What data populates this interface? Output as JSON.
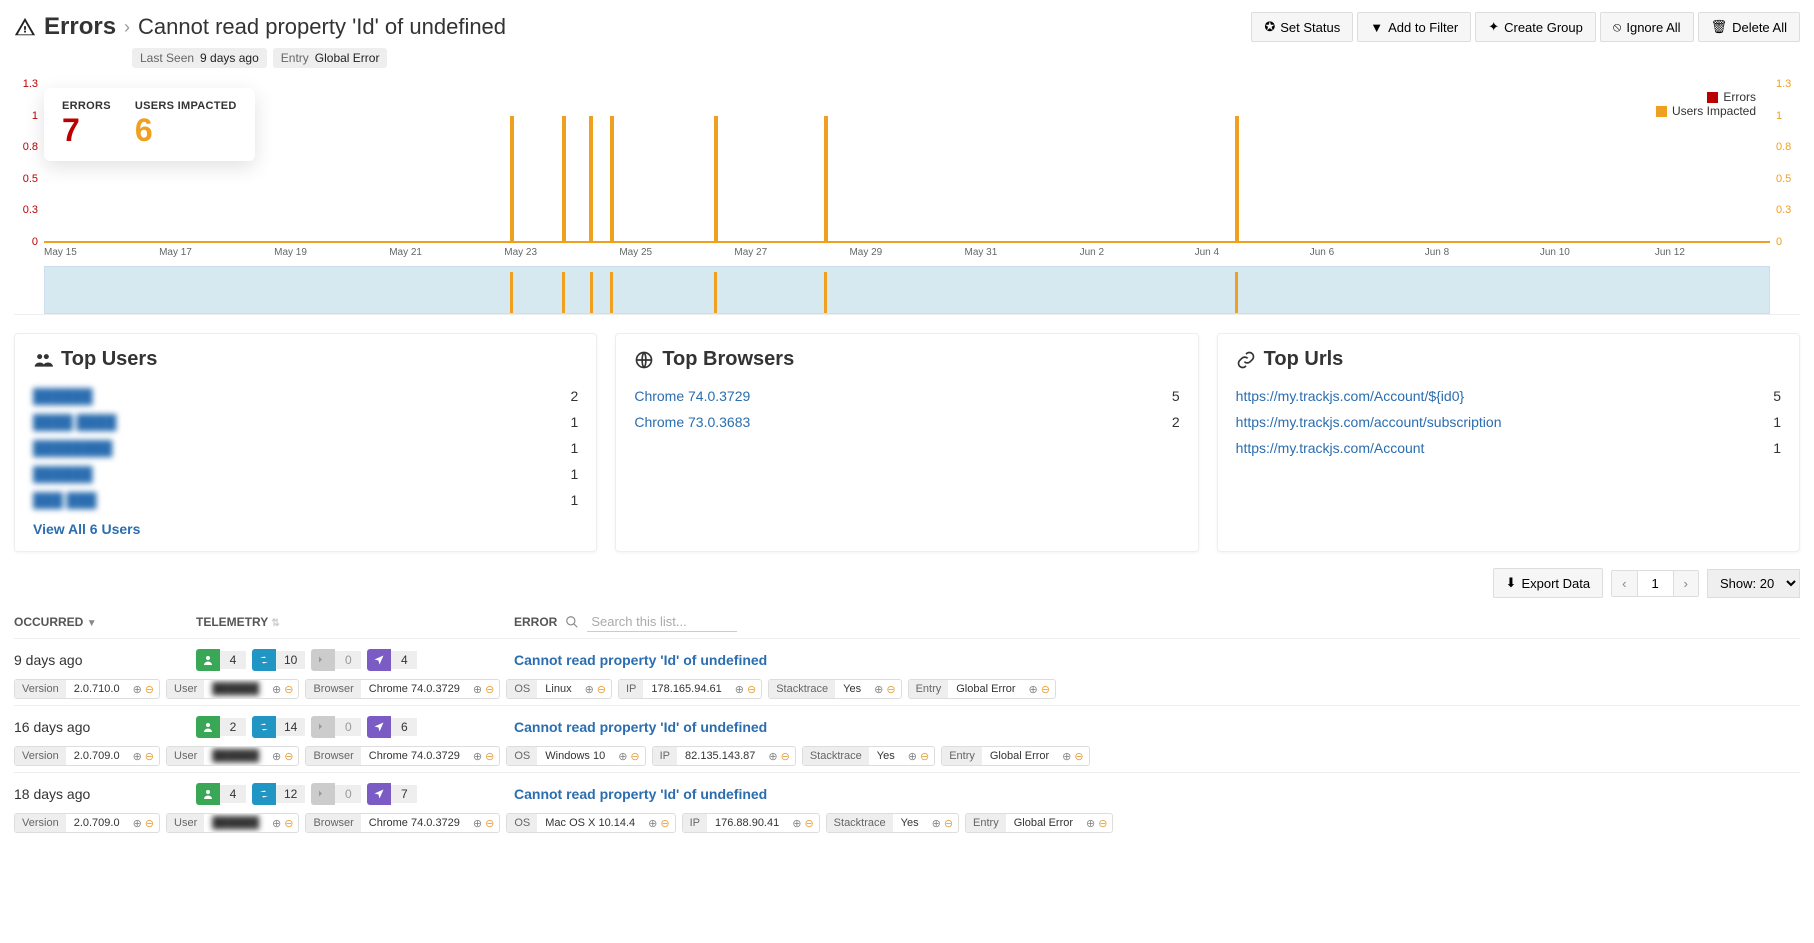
{
  "header": {
    "title": "Errors",
    "subtitle": "Cannot read property 'Id' of undefined",
    "actions": {
      "set_status": "Set Status",
      "add_filter": "Add to Filter",
      "create_group": "Create Group",
      "ignore_all": "Ignore All",
      "delete_all": "Delete All"
    },
    "tags": [
      {
        "key": "Last Seen",
        "val": "9 days ago"
      },
      {
        "key": "Entry",
        "val": "Global Error"
      }
    ]
  },
  "stats": {
    "errors_label": "ERRORS",
    "errors_value": "7",
    "users_label": "USERS IMPACTED",
    "users_value": "6"
  },
  "legend": {
    "errors": "Errors",
    "users": "Users Impacted"
  },
  "chart_data": {
    "type": "bar",
    "y_ticks": [
      "1.3",
      "1",
      "0.8",
      "0.5",
      "0.3",
      "0"
    ],
    "categories": [
      "May 15",
      "May 17",
      "May 19",
      "May 21",
      "May 23",
      "May 25",
      "May 27",
      "May 29",
      "May 31",
      "Jun 2",
      "Jun 4",
      "Jun 6",
      "Jun 8",
      "Jun 10",
      "Jun 12"
    ],
    "bars": [
      {
        "pct": 27.0,
        "h": 1
      },
      {
        "pct": 30.0,
        "h": 1
      },
      {
        "pct": 31.6,
        "h": 1
      },
      {
        "pct": 32.8,
        "h": 1
      },
      {
        "pct": 38.8,
        "h": 1
      },
      {
        "pct": 45.2,
        "h": 1
      },
      {
        "pct": 69.0,
        "h": 1
      }
    ],
    "ylim": [
      0,
      1.3
    ]
  },
  "top_users": {
    "title": "Top Users",
    "rows": [
      {
        "name": "██████",
        "count": "2"
      },
      {
        "name": "████ ████",
        "count": "1"
      },
      {
        "name": "████████",
        "count": "1"
      },
      {
        "name": "██████",
        "count": "1"
      },
      {
        "name": "███ ███",
        "count": "1"
      }
    ],
    "viewall": "View All 6 Users"
  },
  "top_browsers": {
    "title": "Top Browsers",
    "rows": [
      {
        "name": "Chrome 74.0.3729",
        "count": "5"
      },
      {
        "name": "Chrome 73.0.3683",
        "count": "2"
      }
    ]
  },
  "top_urls": {
    "title": "Top Urls",
    "rows": [
      {
        "name": "https://my.trackjs.com/Account/${id0}",
        "count": "5"
      },
      {
        "name": "https://my.trackjs.com/account/subscription",
        "count": "1"
      },
      {
        "name": "https://my.trackjs.com/Account",
        "count": "1"
      }
    ]
  },
  "toolbar": {
    "export": "Export Data",
    "page": "1",
    "show_label": "Show: 20"
  },
  "list_head": {
    "occurred": "OCCURRED",
    "telemetry": "TELEMETRY",
    "error": "ERROR",
    "search_placeholder": "Search this list..."
  },
  "errors": [
    {
      "time": "9 days ago",
      "tel": {
        "u": "4",
        "n": "10",
        "c": "0",
        "a": "4"
      },
      "msg": "Cannot read property 'Id' of undefined",
      "tags": [
        {
          "k": "Version",
          "v": "2.0.710.0"
        },
        {
          "k": "User",
          "v": "██████"
        },
        {
          "k": "Browser",
          "v": "Chrome 74.0.3729"
        },
        {
          "k": "OS",
          "v": "Linux"
        },
        {
          "k": "IP",
          "v": "178.165.94.61"
        },
        {
          "k": "Stacktrace",
          "v": "Yes"
        },
        {
          "k": "Entry",
          "v": "Global Error"
        }
      ]
    },
    {
      "time": "16 days ago",
      "tel": {
        "u": "2",
        "n": "14",
        "c": "0",
        "a": "6"
      },
      "msg": "Cannot read property 'Id' of undefined",
      "tags": [
        {
          "k": "Version",
          "v": "2.0.709.0"
        },
        {
          "k": "User",
          "v": "██████"
        },
        {
          "k": "Browser",
          "v": "Chrome 74.0.3729"
        },
        {
          "k": "OS",
          "v": "Windows 10"
        },
        {
          "k": "IP",
          "v": "82.135.143.87"
        },
        {
          "k": "Stacktrace",
          "v": "Yes"
        },
        {
          "k": "Entry",
          "v": "Global Error"
        }
      ]
    },
    {
      "time": "18 days ago",
      "tel": {
        "u": "4",
        "n": "12",
        "c": "0",
        "a": "7"
      },
      "msg": "Cannot read property 'Id' of undefined",
      "tags": [
        {
          "k": "Version",
          "v": "2.0.709.0"
        },
        {
          "k": "User",
          "v": "██████"
        },
        {
          "k": "Browser",
          "v": "Chrome 74.0.3729"
        },
        {
          "k": "OS",
          "v": "Mac OS X 10.14.4"
        },
        {
          "k": "IP",
          "v": "176.88.90.41"
        },
        {
          "k": "Stacktrace",
          "v": "Yes"
        },
        {
          "k": "Entry",
          "v": "Global Error"
        }
      ]
    }
  ]
}
